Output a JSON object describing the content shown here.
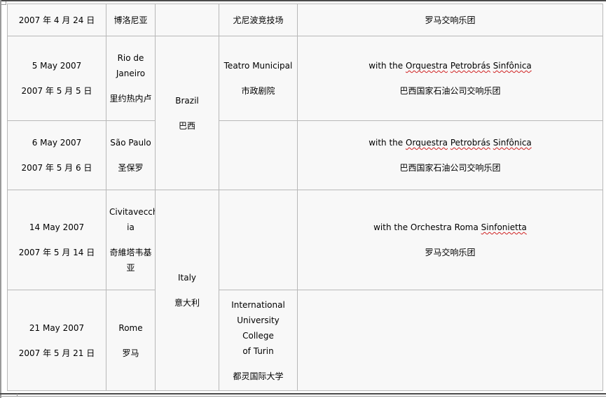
{
  "rows": [
    {
      "date": {
        "en": "",
        "zh": "2007 年 4 月 24 日"
      },
      "city": {
        "en": "",
        "zh": "博洛尼亚"
      },
      "venue": {
        "en": "",
        "zh": "尤尼波竞技场"
      },
      "notes": {
        "prefix": "",
        "name_parts": [],
        "zh": "罗马交响乐团"
      }
    },
    {
      "date": {
        "en": "5 May 2007",
        "zh": "2007 年 5 月 5 日"
      },
      "city": {
        "en_line1": "Rio de",
        "en_line2": "Janeiro",
        "zh": "里约热内卢"
      },
      "venue": {
        "en": "Teatro Municipal",
        "zh": "市政剧院"
      },
      "notes": {
        "prefix": "with the",
        "name_parts": [
          "Orquestra",
          "Petrobrás",
          "Sinfônica"
        ],
        "zh": "巴西国家石油公司交响乐团"
      }
    },
    {
      "date": {
        "en": "6 May 2007",
        "zh": "2007 年 5 月 6 日"
      },
      "city": {
        "en": "São Paulo",
        "zh": "圣保罗"
      },
      "venue": {
        "en": "",
        "zh": ""
      },
      "notes": {
        "prefix": "with the",
        "name_parts": [
          "Orquestra",
          "Petrobrás",
          "Sinfônica"
        ],
        "zh": "巴西国家石油公司交响乐团"
      }
    },
    {
      "date": {
        "en": "14 May 2007",
        "zh": "2007 年 5 月 14 日"
      },
      "city": {
        "en_line1": "Civitavecch",
        "en_line2": "ia",
        "zh_line1": "奇維塔韦基",
        "zh_line2": "亚"
      },
      "venue": {
        "en": "",
        "zh": ""
      },
      "notes": {
        "prefix": "with the Orchestra Roma",
        "name_parts": [
          "Sinfonietta"
        ],
        "zh": "罗马交响乐团"
      }
    },
    {
      "date": {
        "en": "21 May 2007",
        "zh": "2007 年 5 月 21 日"
      },
      "city": {
        "en": "Rome",
        "zh": "罗马"
      },
      "venue": {
        "en_line1": "International",
        "en_line2": "University College",
        "en_line3": "of Turin",
        "zh": "都灵国际大学"
      },
      "notes": {
        "prefix": "",
        "name_parts": [],
        "zh": ""
      }
    }
  ],
  "countries": {
    "brazil": {
      "en": "Brazil",
      "zh": "巴西"
    },
    "italy": {
      "en": "Italy",
      "zh": "意大利"
    }
  },
  "colors": {
    "cell_background": "#f8f8f8",
    "grid_line": "#b8b8b8",
    "spellcheck_underline": "#d02020"
  }
}
